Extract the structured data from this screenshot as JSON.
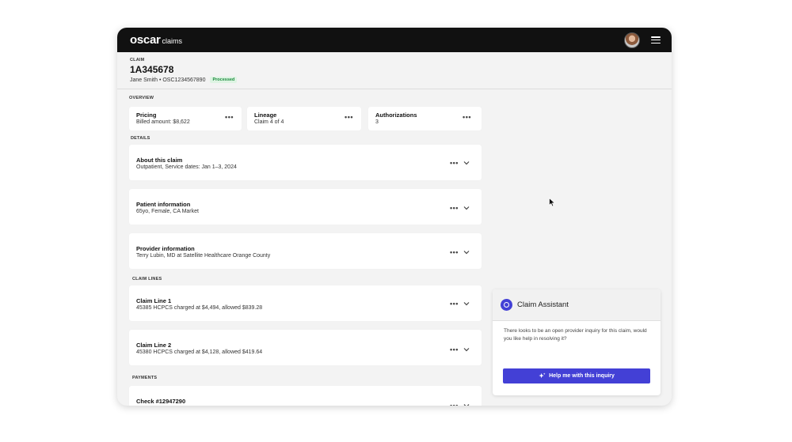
{
  "app": {
    "brand_name": "oscar",
    "brand_sub": "claims"
  },
  "claim": {
    "kicker": "CLAIM",
    "id": "1A345678",
    "meta": "Jane Smith • OSC1234567890",
    "status": "Processed"
  },
  "overview": {
    "label": "OVERVIEW",
    "cards": [
      {
        "title": "Pricing",
        "sub": "Billed amount: $8,622"
      },
      {
        "title": "Lineage",
        "sub": "Claim 4 of 4"
      },
      {
        "title": "Authorizations",
        "sub": "3"
      }
    ]
  },
  "details": {
    "label": "DETAILS",
    "cards": [
      {
        "title": "About this claim",
        "sub": "Outpatient, Service dates: Jan 1–3, 2024"
      },
      {
        "title": "Patient information",
        "sub": "65yo, Female, CA Market"
      },
      {
        "title": "Provider information",
        "sub": "Terry Lubin, MD at Satellite Healthcare Orange County"
      }
    ]
  },
  "claim_lines": {
    "label": "CLAIM LINES",
    "cards": [
      {
        "title": "Claim Line 1",
        "sub": "45385 HCPCS charged at $4,494, allowed $839.28"
      },
      {
        "title": "Claim Line 2",
        "sub": "45380 HCPCS charged at $4,128, allowed $419.64"
      }
    ]
  },
  "payments": {
    "label": "PAYMENTS",
    "cards": [
      {
        "title": "Check #12947290"
      }
    ]
  },
  "assistant": {
    "title": "Claim Assistant",
    "message": "There looks to be an open provider inquiry for this claim, would you like help in resolving it?",
    "button_label": "Help me with this inquiry"
  },
  "more_glyph": "•••",
  "colors": {
    "topbar": "#111111",
    "accent": "#4340d6",
    "status_green": "#1a8a3c"
  },
  "icons": [
    "avatar",
    "hamburger-menu-icon",
    "more-icon",
    "chevron-down-icon",
    "sparkle-icon",
    "assistant-logo-icon",
    "mouse-cursor-icon"
  ]
}
